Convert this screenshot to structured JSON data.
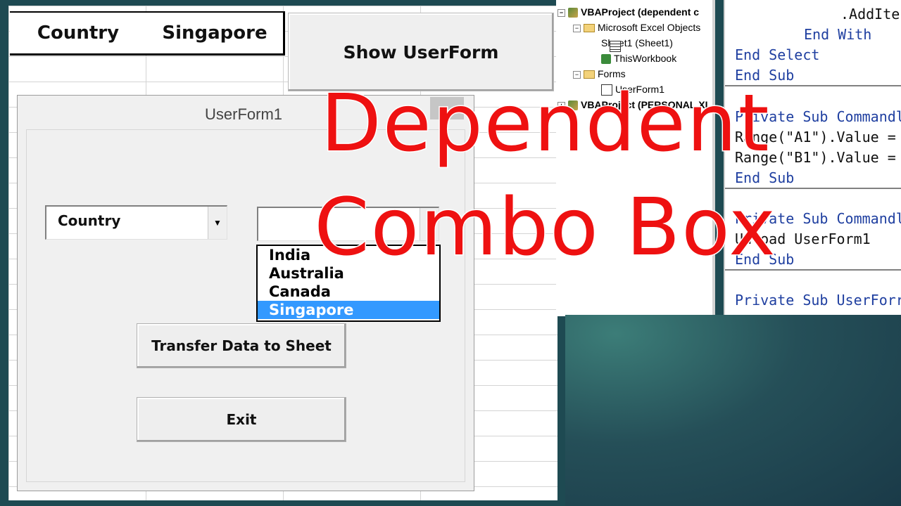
{
  "sheet": {
    "cell_a1": "Country",
    "cell_b1": "Singapore",
    "show_button_label": "Show UserForm"
  },
  "userform": {
    "title": "UserForm1",
    "combo1_value": "Country",
    "combo2_value": "",
    "dropdown_options": [
      "India",
      "Australia",
      "Canada",
      "Singapore"
    ],
    "selected_option": "Singapore",
    "transfer_button_label": "Transfer Data to Sheet",
    "exit_button_label": "Exit"
  },
  "explorer": {
    "items": [
      {
        "label": "VBAProject (dependent c",
        "icon": "project-icon",
        "expander": "−"
      },
      {
        "label": "Microsoft Excel Objects",
        "icon": "folder-icon",
        "expander": "−"
      },
      {
        "label": "Sheet1 (Sheet1)",
        "icon": "sheet-icon"
      },
      {
        "label": "ThisWorkbook",
        "icon": "workbook-icon"
      },
      {
        "label": "Forms",
        "icon": "folder-icon",
        "expander": "−"
      },
      {
        "label": "UserForm1",
        "icon": "form-icon"
      },
      {
        "label": "VBAProject (PERSONAL.XI",
        "icon": "project-icon",
        "expander": "+"
      }
    ]
  },
  "code": {
    "lines": [
      ".AddIter",
      "End With",
      "End Select",
      "End Sub",
      "Private Sub Commandl",
      "Range(\"A1\").Value =",
      "Range(\"B1\").Value =",
      "End Sub",
      "Private Sub Commandl",
      "Unload UserForm1",
      "End Sub",
      "Private Sub UserForr"
    ]
  },
  "overlay": {
    "line1": "Dependent",
    "line2": "Combo Box"
  },
  "colors": {
    "overlay_text": "#ee1111",
    "selection": "#3399ff",
    "keyword": "#1f3fa0",
    "background": "#1e4a52"
  }
}
